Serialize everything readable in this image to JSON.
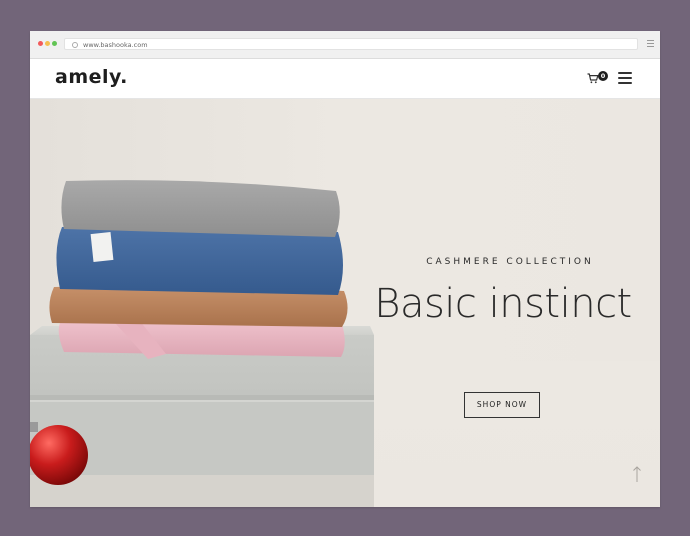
{
  "browser": {
    "url": "www.bashooka.com"
  },
  "site": {
    "logo": "amely.",
    "cart_count": "0"
  },
  "hero": {
    "kicker": "CASHMERE COLLECTION",
    "headline": "Basic instinct",
    "cta_label": "SHOP NOW"
  },
  "colors": {
    "backdrop": "#726579",
    "hero_background": "#ebe7e1",
    "text_dark": "#2a2a2a"
  },
  "icons": [
    "cart-icon",
    "hamburger-menu-icon",
    "scroll-top-arrow-icon"
  ]
}
